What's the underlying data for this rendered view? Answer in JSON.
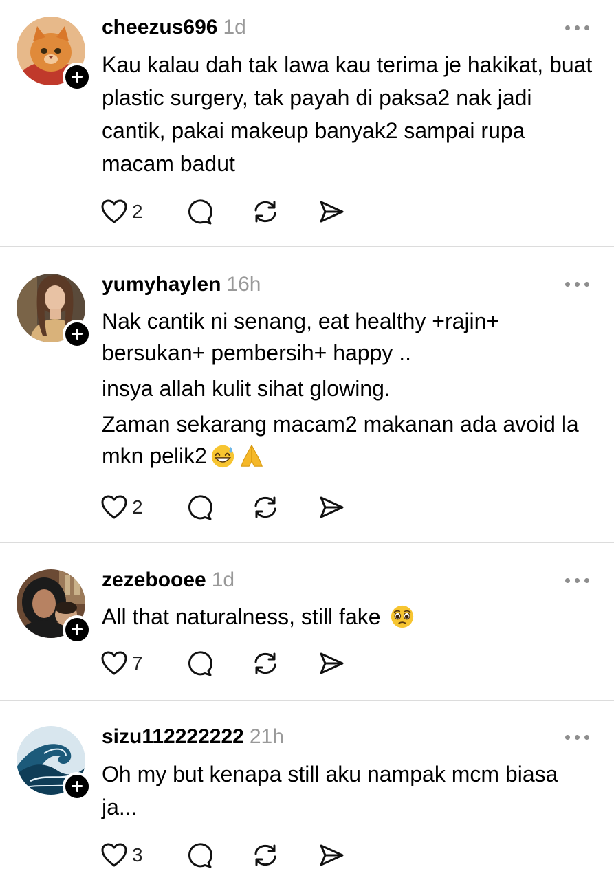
{
  "posts": [
    {
      "username": "cheezus696",
      "time": "1d",
      "avatar": "cat-avatar",
      "lines": [
        "Kau kalau dah tak lawa kau terima je hakikat, buat plastic surgery, tak payah di paksa2 nak jadi cantik, pakai makeup banyak2 sampai rupa macam badut"
      ],
      "likes": "2"
    },
    {
      "username": "yumyhaylen",
      "time": "16h",
      "avatar": "woman-photo-avatar",
      "lines": [
        "Nak cantik ni senang, eat healthy +rajin+ bersukan+ pembersih+ happy ..",
        "insya allah kulit sihat glowing.",
        "Zaman sekarang macam2 makanan ada avoid la mkn pelik2"
      ],
      "emoji": [
        "grinning-sweat-emoji",
        "folded-hands-emoji"
      ],
      "likes": "2"
    },
    {
      "username": "zezebooee",
      "time": "1d",
      "avatar": "hijab-woman-avatar",
      "lines": [
        "All that naturalness, still fake"
      ],
      "emoji": [
        "pleading-face-emoji"
      ],
      "likes": "7"
    },
    {
      "username": "sizu112222222",
      "time": "21h",
      "avatar": "wave-avatar",
      "lines": [
        "Oh my but kenapa still aku nampak mcm biasa ja..."
      ],
      "likes": "3"
    }
  ],
  "colors": {
    "separator": "#dcdcdc",
    "timestamp": "#999999",
    "follow_badge": "#000000"
  },
  "icons": [
    "heart-icon",
    "comment-icon",
    "repost-icon",
    "share-icon",
    "more-icon",
    "follow-plus-icon"
  ]
}
